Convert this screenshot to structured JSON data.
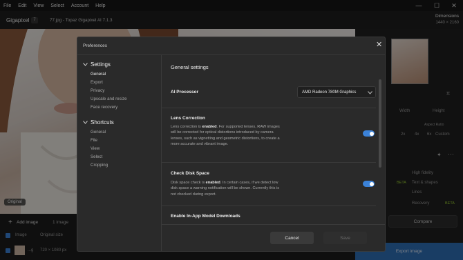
{
  "menu": [
    "File",
    "Edit",
    "View",
    "Select",
    "Account",
    "Help"
  ],
  "window": {
    "minimize": "—",
    "maximize": "☐",
    "close": "✕"
  },
  "titlebar": {
    "app_name": "Gigapixel",
    "version_badge": "7",
    "document_title": "77.jpg - Topaz Gigapixel AI 7.1.3",
    "dimensions_label": "Dimensions",
    "dimensions_value": "1440 × 2160"
  },
  "canvas": {
    "original_badge": "Original"
  },
  "bottom_bar": {
    "add_image": "Add image",
    "image_count": "1 image",
    "col_image": "Image",
    "col_size": "Original size",
    "row_name": "...g",
    "row_size": "720 × 1080 px"
  },
  "right_panel": {
    "width_label": "Width",
    "height_label": "Height",
    "tab_2x": "2x",
    "tab_4x": "4x",
    "tab_6x": "6x",
    "tab_custom": "Custom",
    "model_high_fidelity": "High fidelity",
    "model_text_shapes": "Text & shapes",
    "model_lines": "Lines",
    "model_recovery": "Recovery",
    "beta1": "BETA",
    "beta2": "BETA",
    "compare": "Compare",
    "export": "Export image",
    "aspect_text": "Aspect Ratio"
  },
  "dialog": {
    "title": "Preferences",
    "nav": {
      "settings_header": "Settings",
      "settings_items": [
        "General",
        "Export",
        "Privacy",
        "Upscale and resize",
        "Face recovery"
      ],
      "shortcuts_header": "Shortcuts",
      "shortcuts_items": [
        "General",
        "File",
        "View",
        "Select",
        "Cropping"
      ]
    },
    "content": {
      "heading": "General settings",
      "ai_processor_label": "AI Processor",
      "ai_processor_value": "AMD Radeon 780M Graphics",
      "lens_title": "Lens Correction",
      "lens_pre": "Lens correction is ",
      "lens_bold": "enabled",
      "lens_post": ". For supported lenses, RAW images will be corrected for optical distortions introduced by camera lenses, such as vignetting and geometric distortions, to create a more accurate and vibrant image.",
      "disk_title": "Check Disk Space",
      "disk_pre": "Disk space check is ",
      "disk_bold": "enabled",
      "disk_post": ". In certain cases, if we detect low disk space a warning notification will be shown. Currently this is not checked during export.",
      "downloads_title": "Enable In-App Model Downloads"
    },
    "footer": {
      "cancel": "Cancel",
      "save": "Save"
    },
    "toggles": {
      "lens_correction": true,
      "check_disk_space": true
    }
  },
  "colors": {
    "accent": "#3b82d8",
    "beta": "#9acd32",
    "export_button": "#2f6fb6"
  }
}
